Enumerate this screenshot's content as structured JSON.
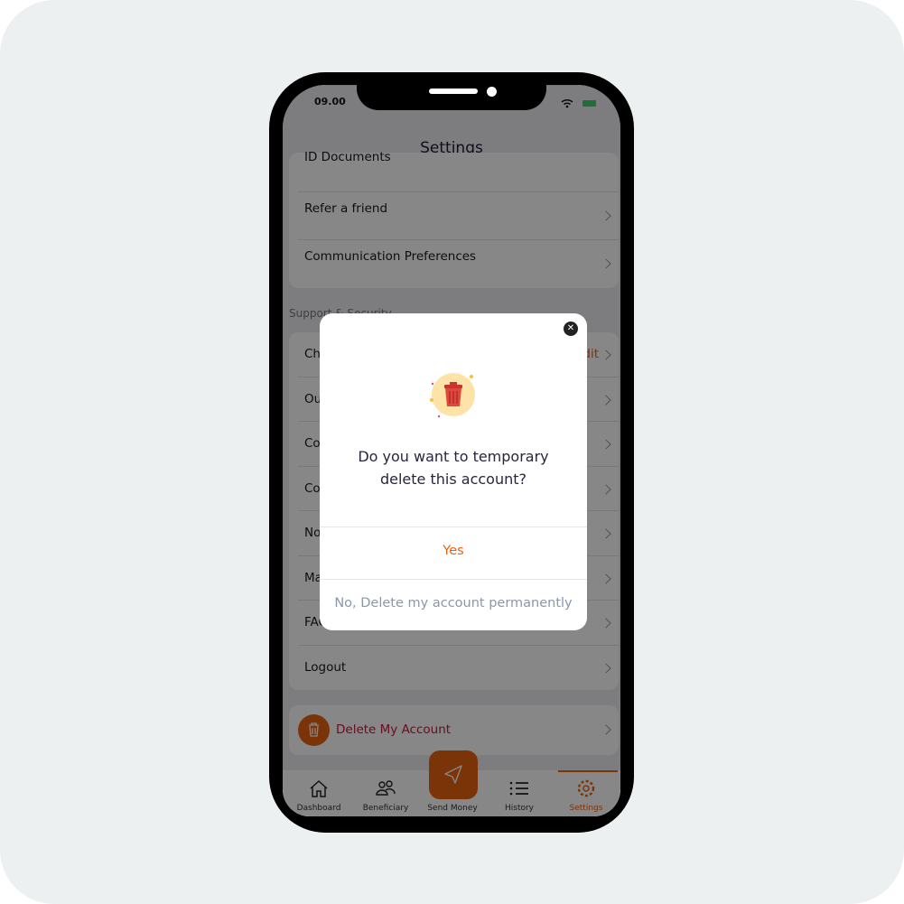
{
  "status_bar": {
    "time": "09.00"
  },
  "header": {
    "title": "Settings"
  },
  "account_section": {
    "items": [
      {
        "label": "ID Documents"
      },
      {
        "label": "Refer a friend"
      },
      {
        "label": "Communication Preferences"
      }
    ]
  },
  "support_section": {
    "title": "Support & Security",
    "items": [
      {
        "label": "Cha",
        "value": "dit"
      },
      {
        "label": "Our"
      },
      {
        "label": "Con"
      },
      {
        "label": "Con"
      },
      {
        "label": "Not"
      },
      {
        "label": "Mar"
      },
      {
        "label": "FAQ"
      },
      {
        "label": "Logout"
      }
    ]
  },
  "delete_account": {
    "label": "Delete My Account",
    "icon": "trash-icon"
  },
  "tabbar": {
    "items": [
      {
        "label": "Dashboard",
        "icon": "home-icon"
      },
      {
        "label": "Beneficiary",
        "icon": "users-icon"
      },
      {
        "label": "Send Money",
        "icon": "send-icon"
      },
      {
        "label": "History",
        "icon": "list-icon"
      },
      {
        "label": "Settings",
        "icon": "gear-icon",
        "active": true
      }
    ]
  },
  "modal": {
    "question": "Do you want to temporary delete this account?",
    "yes_label": "Yes",
    "no_label": "No, Delete my account permanently"
  },
  "colors": {
    "accent": "#e8620e",
    "danger": "#c8193c",
    "muted_button": "#8a97ab"
  }
}
